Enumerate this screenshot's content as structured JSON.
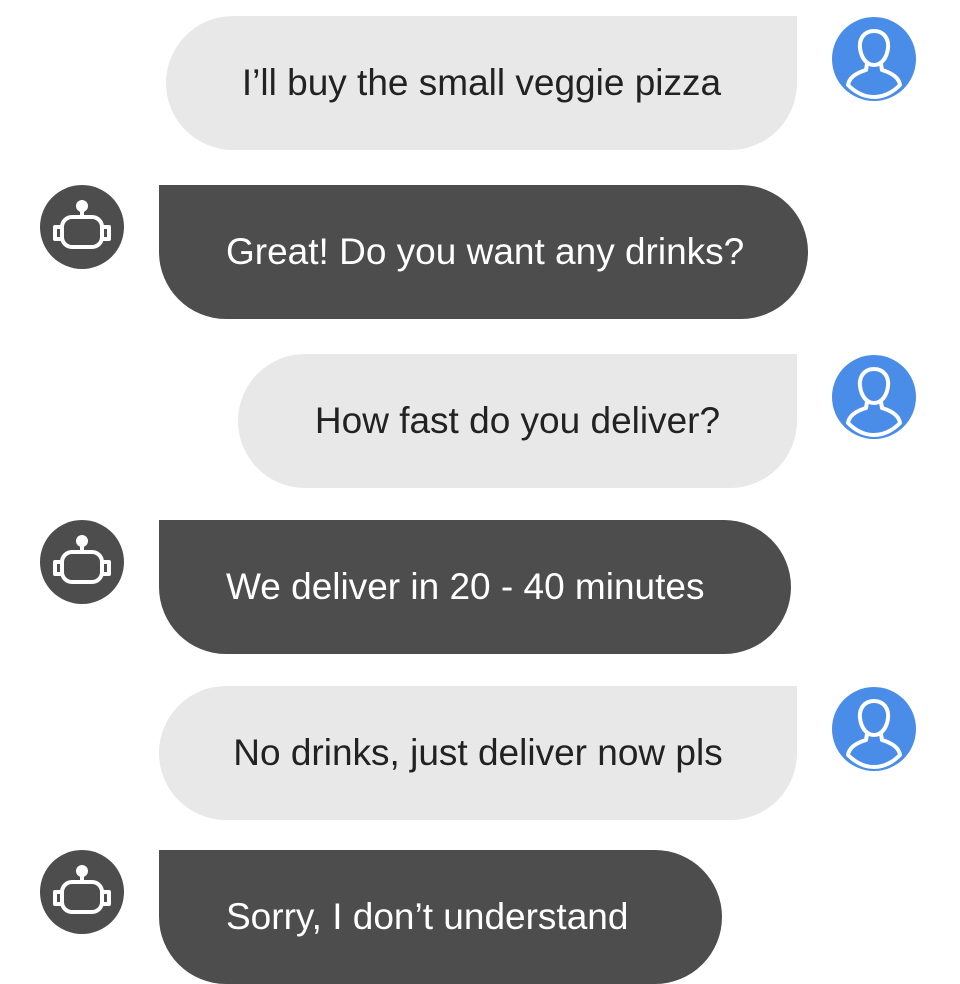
{
  "conversation": {
    "messages": [
      {
        "sender": "user",
        "text": "I’ll buy the small veggie pizza"
      },
      {
        "sender": "bot",
        "text": "Great! Do you want any drinks?"
      },
      {
        "sender": "user",
        "text": "How fast do you deliver?"
      },
      {
        "sender": "bot",
        "text": "We deliver in 20 - 40 minutes"
      },
      {
        "sender": "user",
        "text": "No drinks, just deliver now pls"
      },
      {
        "sender": "bot",
        "text": "Sorry, I don’t understand"
      }
    ],
    "avatars": {
      "user_icon": "user-silhouette-icon",
      "bot_icon": "robot-head-icon"
    }
  },
  "theme": {
    "user_bubble_color": "#e8e8e8",
    "user_text_color": "#222222",
    "bot_bubble_color": "#4d4d4d",
    "bot_text_color": "#ffffff",
    "user_avatar_color": "#4a8de8",
    "bot_avatar_color": "#4d4d4d"
  }
}
